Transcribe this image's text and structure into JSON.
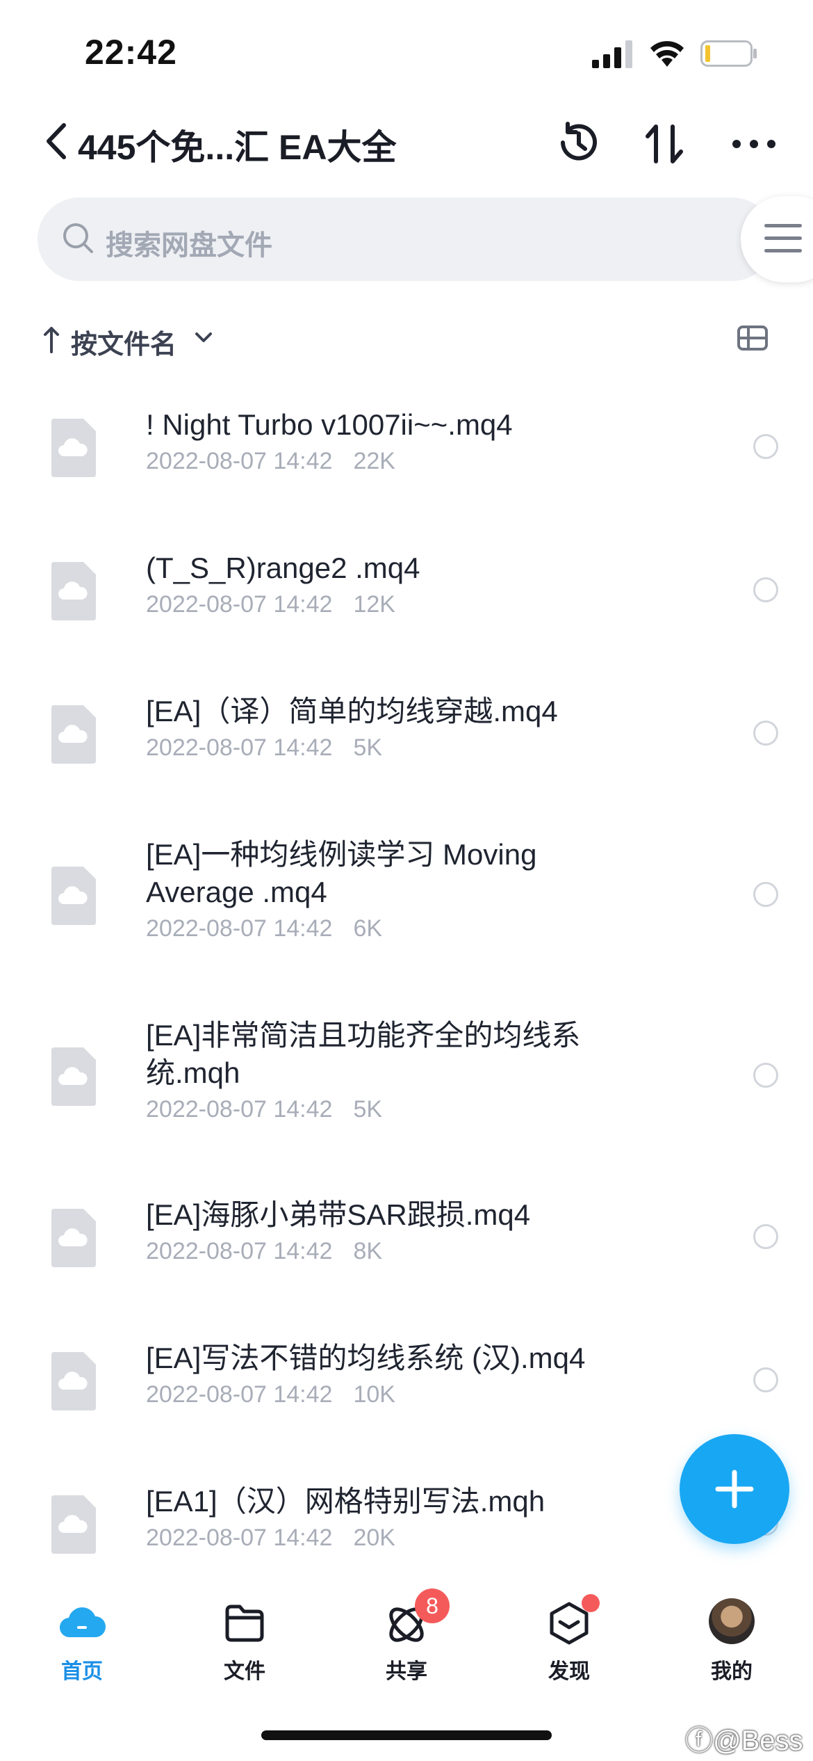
{
  "status_bar": {
    "time": "22:42"
  },
  "header": {
    "title": "445个免...汇 EA大全"
  },
  "search": {
    "placeholder": "搜索网盘文件"
  },
  "sort": {
    "label": "按文件名"
  },
  "files": [
    {
      "name": "! Night Turbo v1007ii~~.mq4",
      "date": "2022-08-07 14:42",
      "size": "22K"
    },
    {
      "name": "(T_S_R)range2 .mq4",
      "date": "2022-08-07 14:42",
      "size": "12K"
    },
    {
      "name": "[EA]（译）简单的均线穿越.mq4",
      "date": "2022-08-07 14:42",
      "size": "5K"
    },
    {
      "name": "[EA]一种均线例读学习 Moving Average .mq4",
      "date": "2022-08-07 14:42",
      "size": "6K"
    },
    {
      "name": "[EA]非常简洁且功能齐全的均线系统.mqh",
      "date": "2022-08-07 14:42",
      "size": "5K"
    },
    {
      "name": "[EA]海豚小弟带SAR跟损.mq4",
      "date": "2022-08-07 14:42",
      "size": "8K"
    },
    {
      "name": "[EA]写法不错的均线系统 (汉).mq4",
      "date": "2022-08-07 14:42",
      "size": "10K"
    },
    {
      "name": "[EA1]（汉）网格特别写法.mqh",
      "date": "2022-08-07 14:42",
      "size": "20K"
    }
  ],
  "bottom_nav": {
    "items": [
      {
        "label": "首页",
        "icon": "cloud-home-icon",
        "active": true
      },
      {
        "label": "文件",
        "icon": "folder-icon"
      },
      {
        "label": "共享",
        "icon": "share-orbit-icon",
        "badge": "8"
      },
      {
        "label": "发现",
        "icon": "discover-cube-icon",
        "dot": true
      },
      {
        "label": "我的",
        "icon": "avatar"
      }
    ]
  },
  "watermark": "ⓕ@Bess",
  "colors": {
    "accent": "#18a7f3",
    "active_nav": "#1a8fe6",
    "badge": "#f55a5a",
    "search_bg": "#eef0f4"
  }
}
